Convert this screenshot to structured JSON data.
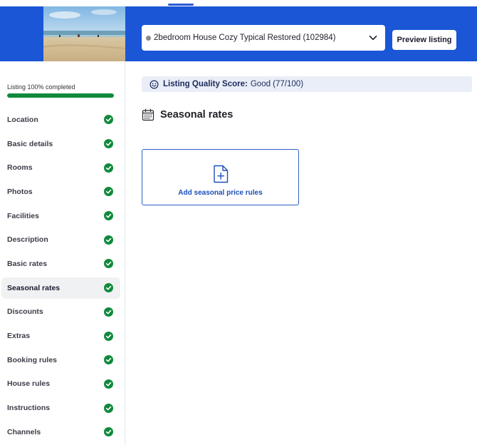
{
  "colors": {
    "header_bg": "#1a56d6",
    "accent": "#1a4fb8",
    "success": "#0f8a3c",
    "score_bg": "#e9eef8"
  },
  "header": {
    "listing_selector": {
      "value": "2bedroom House Cozy Typical Restored (102984)",
      "status_dot": "grey-dot",
      "icon": "chevron-down-icon"
    },
    "preview_label": "Preview listing"
  },
  "sidebar": {
    "progress_label": "Listing 100% completed",
    "progress_percent": 100,
    "items": [
      {
        "label": "Location",
        "done": true
      },
      {
        "label": "Basic details",
        "done": true
      },
      {
        "label": "Rooms",
        "done": true
      },
      {
        "label": "Photos",
        "done": true
      },
      {
        "label": "Facilities",
        "done": true
      },
      {
        "label": "Description",
        "done": true
      },
      {
        "label": "Basic rates",
        "done": true
      },
      {
        "label": "Seasonal rates",
        "done": true,
        "active": true
      },
      {
        "label": "Discounts",
        "done": true
      },
      {
        "label": "Extras",
        "done": true
      },
      {
        "label": "Booking rules",
        "done": true
      },
      {
        "label": "House rules",
        "done": true
      },
      {
        "label": "Instructions",
        "done": true
      },
      {
        "label": "Channels",
        "done": true
      }
    ]
  },
  "main": {
    "quality": {
      "title": "Listing Quality Score:",
      "value": "Good (77/100)",
      "icon": "smiley-icon"
    },
    "section_title": "Seasonal rates",
    "section_icon": "calendar-icon",
    "add_card": {
      "label": "Add seasonal price rules",
      "icon": "add-document-icon"
    }
  }
}
